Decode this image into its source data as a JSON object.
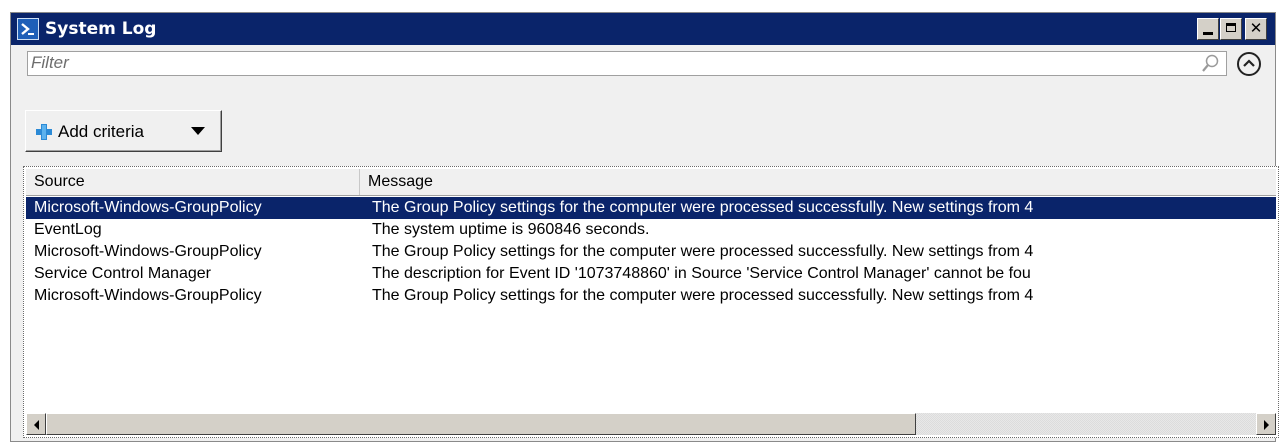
{
  "window": {
    "title": "System Log",
    "icon": "powershell-icon",
    "caption_buttons": {
      "minimize_icon": "minimize-icon",
      "maximize_icon": "maximize-icon",
      "close_icon": "close-icon",
      "close_glyph": "✕"
    }
  },
  "filter": {
    "placeholder": "Filter",
    "value": "",
    "search_icon": "search-icon",
    "collapse_icon": "chevron-up-circle-icon"
  },
  "toolbar": {
    "add_criteria_label": "Add criteria",
    "add_icon": "plus-icon",
    "dropdown_icon": "caret-down-icon"
  },
  "grid": {
    "columns": [
      "Source",
      "Message"
    ],
    "rows": [
      {
        "source": "Microsoft-Windows-GroupPolicy",
        "message": "The Group Policy settings for the computer were processed successfully. New settings from 4",
        "selected": true
      },
      {
        "source": "EventLog",
        "message": "The system uptime is 960846 seconds.",
        "selected": false
      },
      {
        "source": "Microsoft-Windows-GroupPolicy",
        "message": "The Group Policy settings for the computer were processed successfully. New settings from 4",
        "selected": false
      },
      {
        "source": "Service Control Manager",
        "message": "The description for Event ID '1073748860' in Source 'Service Control Manager' cannot be fou",
        "selected": false
      },
      {
        "source": "Microsoft-Windows-GroupPolicy",
        "message": "The Group Policy settings for the computer were processed successfully. New settings from 4",
        "selected": false
      }
    ]
  },
  "colors": {
    "titlebar": "#0a246a",
    "selection": "#0a246a",
    "selection_text": "#ffffff",
    "window_bg": "#f0f0f0"
  }
}
